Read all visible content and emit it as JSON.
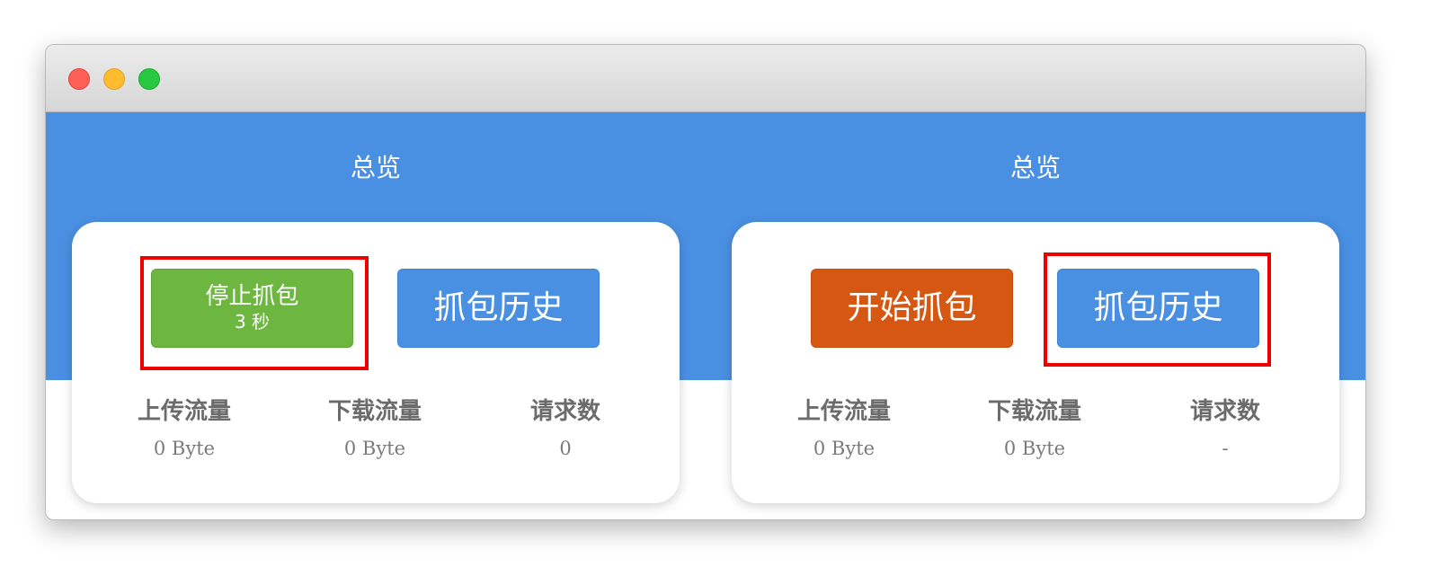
{
  "colors": {
    "header_blue": "#4a90e2",
    "stop_green": "#6db640",
    "history_blue": "#4a90e2",
    "start_orange": "#d65712",
    "highlight_red": "#ee0000"
  },
  "left_panel": {
    "title": "总览",
    "stop_button": {
      "label": "停止抓包",
      "timer": "3 秒"
    },
    "history_button": {
      "label": "抓包历史"
    },
    "stats": [
      {
        "label": "上传流量",
        "value": "0 Byte"
      },
      {
        "label": "下载流量",
        "value": "0 Byte"
      },
      {
        "label": "请求数",
        "value": "0"
      }
    ]
  },
  "right_panel": {
    "title": "总览",
    "start_button": {
      "label": "开始抓包"
    },
    "history_button": {
      "label": "抓包历史"
    },
    "stats": [
      {
        "label": "上传流量",
        "value": "0 Byte"
      },
      {
        "label": "下载流量",
        "value": "0 Byte"
      },
      {
        "label": "请求数",
        "value": "-"
      }
    ]
  }
}
